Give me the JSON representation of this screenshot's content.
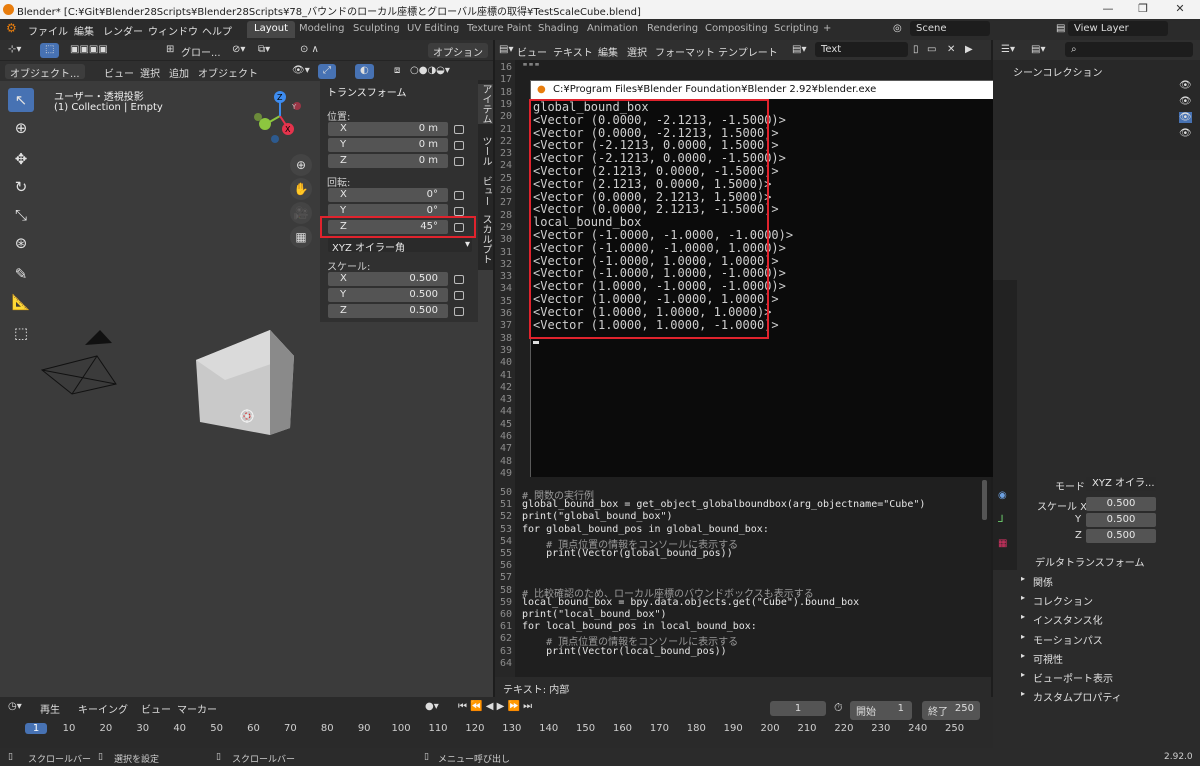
{
  "titlebar": {
    "title": "Blender* [C:¥Git¥Blender28Scripts¥Blender28Scripts¥78_バウンドのローカル座標とグローバル座標の取得¥TestScaleCube.blend]",
    "min": "—",
    "max": "❐",
    "close": "✕"
  },
  "menu": [
    "ファイル",
    "編集",
    "レンダー",
    "ウィンドウ",
    "ヘルプ"
  ],
  "workspaces": [
    "Layout",
    "Modeling",
    "Sculpting",
    "UV Editing",
    "Texture Paint",
    "Shading",
    "Animation",
    "Rendering",
    "Compositing",
    "Scripting",
    "+"
  ],
  "scene": "Scene",
  "view_layer": "View Layer",
  "viewport": {
    "header": {
      "transform_mode": "グロー...",
      "options": "オプション",
      "mode": "オブジェクト...",
      "view": "ビュー",
      "select": "選択",
      "add": "追加",
      "object": "オブジェクト"
    },
    "info_view": "ユーザー・透視投影",
    "info_collection": "(1) Collection | Empty",
    "gizmo": {
      "x": "X",
      "y": "Y",
      "z": "Z"
    },
    "npanel": {
      "title": "トランスフォーム",
      "location_label": "位置:",
      "location": [
        {
          "axis": "X",
          "val": "0 m"
        },
        {
          "axis": "Y",
          "val": "0 m"
        },
        {
          "axis": "Z",
          "val": "0 m"
        }
      ],
      "rotation_label": "回転:",
      "rotation": [
        {
          "axis": "X",
          "val": "0°"
        },
        {
          "axis": "Y",
          "val": "0°"
        },
        {
          "axis": "Z",
          "val": "45°"
        }
      ],
      "rotation_mode": "XYZ オイラー角",
      "scale_label": "スケール:",
      "scale": [
        {
          "axis": "X",
          "val": "0.500"
        },
        {
          "axis": "Y",
          "val": "0.500"
        },
        {
          "axis": "Z",
          "val": "0.500"
        }
      ]
    },
    "vtabs": [
      "アイテム",
      "ツール",
      "ビュー",
      "スカルプト"
    ]
  },
  "text_editor": {
    "header": {
      "view": "ビュー",
      "text": "テキスト",
      "edit": "編集",
      "select": "選択",
      "format": "フォーマット",
      "template": "テンプレート",
      "name": "Text"
    },
    "top_lines": [
      {
        "n": "16",
        "t": "\"\"\""
      },
      {
        "n": "17",
        "t": ""
      },
      {
        "n": "18",
        "t": ""
      },
      {
        "n": "19",
        "t": ""
      },
      {
        "n": "20",
        "t": ""
      },
      {
        "n": "21",
        "t": ""
      },
      {
        "n": "22",
        "t": ""
      },
      {
        "n": "23",
        "t": ""
      },
      {
        "n": "24",
        "t": ""
      },
      {
        "n": "25",
        "t": ""
      },
      {
        "n": "26",
        "t": ""
      },
      {
        "n": "27",
        "t": ""
      },
      {
        "n": "28",
        "t": ""
      },
      {
        "n": "29",
        "t": ""
      },
      {
        "n": "30",
        "t": ""
      },
      {
        "n": "31",
        "t": ""
      },
      {
        "n": "32",
        "t": ""
      },
      {
        "n": "33",
        "t": ""
      },
      {
        "n": "34",
        "t": ""
      },
      {
        "n": "35",
        "t": ""
      },
      {
        "n": "36",
        "t": ""
      },
      {
        "n": "37",
        "t": ""
      },
      {
        "n": "38",
        "t": ""
      },
      {
        "n": "39",
        "t": ""
      },
      {
        "n": "40",
        "t": ""
      },
      {
        "n": "41",
        "t": ""
      },
      {
        "n": "42",
        "t": ""
      },
      {
        "n": "43",
        "t": ""
      },
      {
        "n": "44",
        "t": ""
      },
      {
        "n": "45",
        "t": ""
      },
      {
        "n": "46",
        "t": ""
      },
      {
        "n": "47",
        "t": ""
      },
      {
        "n": "48",
        "t": ""
      },
      {
        "n": "49",
        "t": ""
      }
    ],
    "bottom_lines": [
      {
        "n": "50",
        "t": "# 関数の実行例"
      },
      {
        "n": "51",
        "t": "global_bound_box = get_object_globalboundbox(arg_objectname=\"Cube\")"
      },
      {
        "n": "52",
        "t": "print(\"global_bound_box\")"
      },
      {
        "n": "53",
        "t": "for global_bound_pos in global_bound_box:"
      },
      {
        "n": "54",
        "t": "    # 頂点位置の情報をコンソールに表示する"
      },
      {
        "n": "55",
        "t": "    print(Vector(global_bound_pos))"
      },
      {
        "n": "56",
        "t": ""
      },
      {
        "n": "57",
        "t": ""
      },
      {
        "n": "58",
        "t": "# 比較確認のため、ローカル座標のバウンドボックスも表示する"
      },
      {
        "n": "59",
        "t": "local_bound_box = bpy.data.objects.get(\"Cube\").bound_box"
      },
      {
        "n": "60",
        "t": "print(\"local_bound_box\")"
      },
      {
        "n": "61",
        "t": "for local_bound_pos in local_bound_box:"
      },
      {
        "n": "62",
        "t": "    # 頂点位置の情報をコンソールに表示する"
      },
      {
        "n": "63",
        "t": "    print(Vector(local_bound_pos))"
      },
      {
        "n": "64",
        "t": ""
      }
    ],
    "footer": "テキスト: 内部"
  },
  "console": {
    "title": "C:¥Program Files¥Blender Foundation¥Blender 2.92¥blender.exe",
    "lines": [
      "global_bound_box",
      "<Vector (0.0000, -2.1213, -1.5000)>",
      "<Vector (0.0000, -2.1213, 1.5000)>",
      "<Vector (-2.1213, 0.0000, 1.5000)>",
      "<Vector (-2.1213, 0.0000, -1.5000)>",
      "<Vector (2.1213, 0.0000, -1.5000)>",
      "<Vector (2.1213, 0.0000, 1.5000)>",
      "<Vector (0.0000, 2.1213, 1.5000)>",
      "<Vector (0.0000, 2.1213, -1.5000)>",
      "local_bound_box",
      "<Vector (-1.0000, -1.0000, -1.0000)>",
      "<Vector (-1.0000, -1.0000, 1.0000)>",
      "<Vector (-1.0000, 1.0000, 1.0000)>",
      "<Vector (-1.0000, 1.0000, -1.0000)>",
      "<Vector (1.0000, -1.0000, -1.0000)>",
      "<Vector (1.0000, -1.0000, 1.0000)>",
      "<Vector (1.0000, 1.0000, 1.0000)>",
      "<Vector (1.0000, 1.0000, -1.0000)>"
    ]
  },
  "properties": {
    "scene_collection": "シーンコレクション",
    "mode_label": "モード",
    "mode_value": "XYZ オイラ...",
    "scale_x_label": "スケール X",
    "scale_y_label": "Y",
    "scale_z_label": "Z",
    "scale_values": [
      "0.500",
      "0.500",
      "0.500"
    ],
    "delta": "デルタトランスフォーム",
    "sections": [
      "関係",
      "コレクション",
      "インスタンス化",
      "モーションパス",
      "可視性",
      "ビューポート表示",
      "カスタムプロパティ"
    ]
  },
  "timeline": {
    "playback": "再生",
    "keying": "キーイング",
    "view": "ビュー",
    "marker": "マーカー",
    "current_frame": "1",
    "start_label": "開始",
    "start": "1",
    "end_label": "終了",
    "end": "250",
    "ticks": [
      "1",
      "10",
      "20",
      "30",
      "40",
      "50",
      "60",
      "70",
      "80",
      "90",
      "100",
      "110",
      "120",
      "130",
      "140",
      "150",
      "160",
      "170",
      "180",
      "190",
      "200",
      "210",
      "220",
      "230",
      "240",
      "250"
    ]
  },
  "statusbar": {
    "scrollbar1": "スクロールバー",
    "select_set": "選択を設定",
    "scrollbar2": "スクロールバー",
    "menu_call": "メニュー呼び出し",
    "version": "2.92.0"
  }
}
